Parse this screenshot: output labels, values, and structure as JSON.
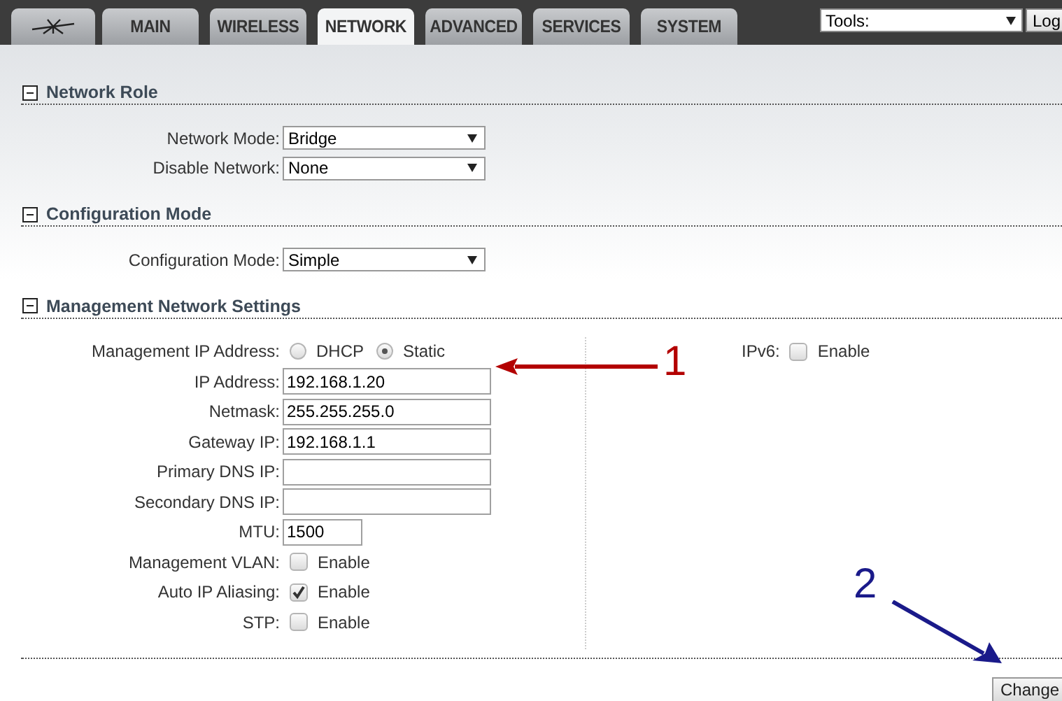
{
  "tabs": [
    {
      "label": "MAIN",
      "selected": false
    },
    {
      "label": "WIRELESS",
      "selected": false
    },
    {
      "label": "NETWORK",
      "selected": true
    },
    {
      "label": "ADVANCED",
      "selected": false
    },
    {
      "label": "SERVICES",
      "selected": false
    },
    {
      "label": "SYSTEM",
      "selected": false
    }
  ],
  "tools": {
    "value": "Tools:"
  },
  "logout_button": "Log",
  "sections": [
    {
      "title": "Network Role",
      "expanded": true,
      "rows": [
        {
          "label": "Network Mode:",
          "kind": "select",
          "value": "Bridge"
        },
        {
          "label": "Disable Network:",
          "kind": "select",
          "value": "None"
        }
      ]
    },
    {
      "title": "Configuration Mode",
      "expanded": true,
      "rows": [
        {
          "label": "Configuration Mode:",
          "kind": "select",
          "value": "Simple"
        }
      ]
    },
    {
      "title": "Management Network Settings",
      "expanded": true,
      "rows": [
        {
          "label": "Management IP Address:",
          "kind": "radio",
          "options": [
            {
              "label": "DHCP",
              "selected": false
            },
            {
              "label": "Static",
              "selected": true
            }
          ]
        },
        {
          "label": "IP Address:",
          "kind": "text",
          "value": "192.168.1.20"
        },
        {
          "label": "Netmask:",
          "kind": "text",
          "value": "255.255.255.0"
        },
        {
          "label": "Gateway IP:",
          "kind": "text",
          "value": "192.168.1.1"
        },
        {
          "label": "Primary DNS IP:",
          "kind": "text"
        },
        {
          "label": "Secondary DNS IP:",
          "kind": "text"
        },
        {
          "label": "MTU:",
          "kind": "short",
          "value": "1500"
        },
        {
          "label": "Management VLAN:",
          "kind": "checkbox",
          "option": "Enable",
          "checked": false
        },
        {
          "label": "Auto IP Aliasing:",
          "kind": "checkbox",
          "option": "Enable",
          "checked": true
        },
        {
          "label": "STP:",
          "kind": "checkbox",
          "option": "Enable",
          "checked": false
        }
      ],
      "side_rows": [
        {
          "label": "IPv6:",
          "kind": "checkbox",
          "option": "Enable",
          "checked": false
        }
      ]
    }
  ],
  "buttons": [
    "Change"
  ],
  "annotations": [
    {
      "label": "1",
      "color": "#b30000"
    },
    {
      "label": "2",
      "color": "#1a1a8a"
    }
  ]
}
